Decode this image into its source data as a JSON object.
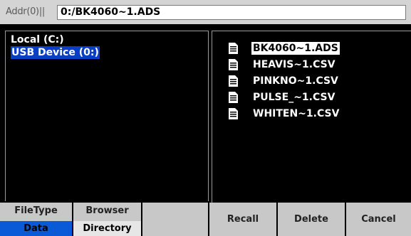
{
  "address": {
    "label": "Addr(0)||",
    "value": "0:/BK4060~1.ADS"
  },
  "drives": [
    {
      "label": "Local (C:)",
      "selected": false
    },
    {
      "label": "USB Device (0:)",
      "selected": true
    }
  ],
  "files": [
    {
      "name": "BK4060~1.ADS",
      "selected": true,
      "icon": "document-icon"
    },
    {
      "name": "HEAVIS~1.CSV",
      "selected": false,
      "icon": "document-icon"
    },
    {
      "name": "PINKNO~1.CSV",
      "selected": false,
      "icon": "document-icon"
    },
    {
      "name": "PULSE_~1.CSV",
      "selected": false,
      "icon": "document-icon"
    },
    {
      "name": "WHITEN~1.CSV",
      "selected": false,
      "icon": "document-icon"
    }
  ],
  "softkeys": {
    "filetype": {
      "title": "FileType",
      "value": "Data"
    },
    "browser": {
      "title": "Browser",
      "value": "Directory"
    },
    "blank": "",
    "recall": "Recall",
    "delete": "Delete",
    "cancel": "Cancel"
  },
  "colors": {
    "selection_blue": "#0a3ec6",
    "softkey_gray": "#c8c8c8",
    "softkey_active": "#0a5ad8"
  }
}
